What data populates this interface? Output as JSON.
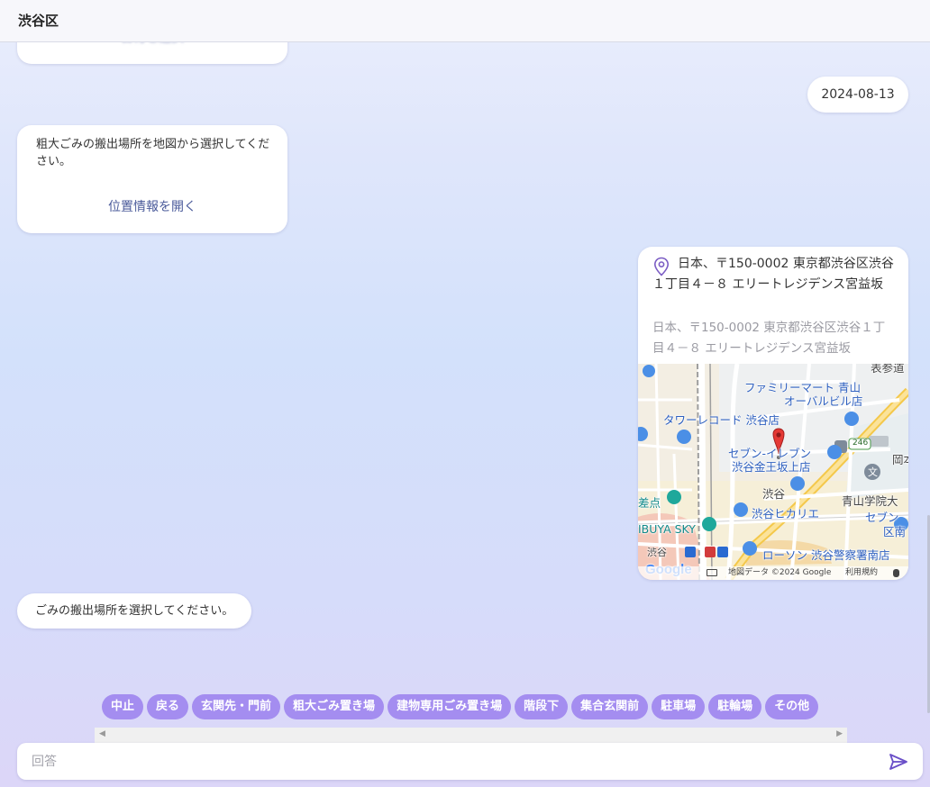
{
  "header": {
    "title": "渋谷区"
  },
  "chat": {
    "top_bubble_link": "日付を選択",
    "user_date": "2024-08-13",
    "location_request": {
      "text": "粗大ごみの搬出場所を地図から選択してください。",
      "link": "位置情報を開く"
    },
    "user_location": {
      "address": "日本、〒150-0002 東京都渋谷区渋谷１丁目４－８ エリートレジデンス宮益坂",
      "address_sub": "日本、〒150-0002 東京都渋谷区渋谷１丁目４－８ エリートレジデンス宮益坂",
      "map": {
        "labels": [
          "表参道",
          "ファミリーマート 青山",
          "オーバルビル店",
          "タワーレコード 渋谷店",
          "セブン-イレブン",
          "渋谷金王坂上店",
          "渋谷",
          "青山学院大",
          "セブン",
          "区南",
          "差点",
          "渋谷ヒカリエ",
          "IBUYA SKY",
          "渋谷",
          "ローソン 渋谷警察署南店",
          "246",
          "岡本",
          "文"
        ],
        "logo": "Google",
        "copyright": "地図データ ©2024 Google",
        "terms": "利用規約"
      }
    },
    "prompt": "ごみの搬出場所を選択してください。"
  },
  "options": [
    "中止",
    "戻る",
    "玄関先・門前",
    "粗大ごみ置き場",
    "建物専用ごみ置き場",
    "階段下",
    "集合玄関前",
    "駐車場",
    "駐輪場",
    "その他"
  ],
  "input": {
    "placeholder": "回答",
    "value": ""
  },
  "colors": {
    "chip": "#a48df0",
    "accent": "#6a4fc8",
    "pin": "#e53935"
  }
}
